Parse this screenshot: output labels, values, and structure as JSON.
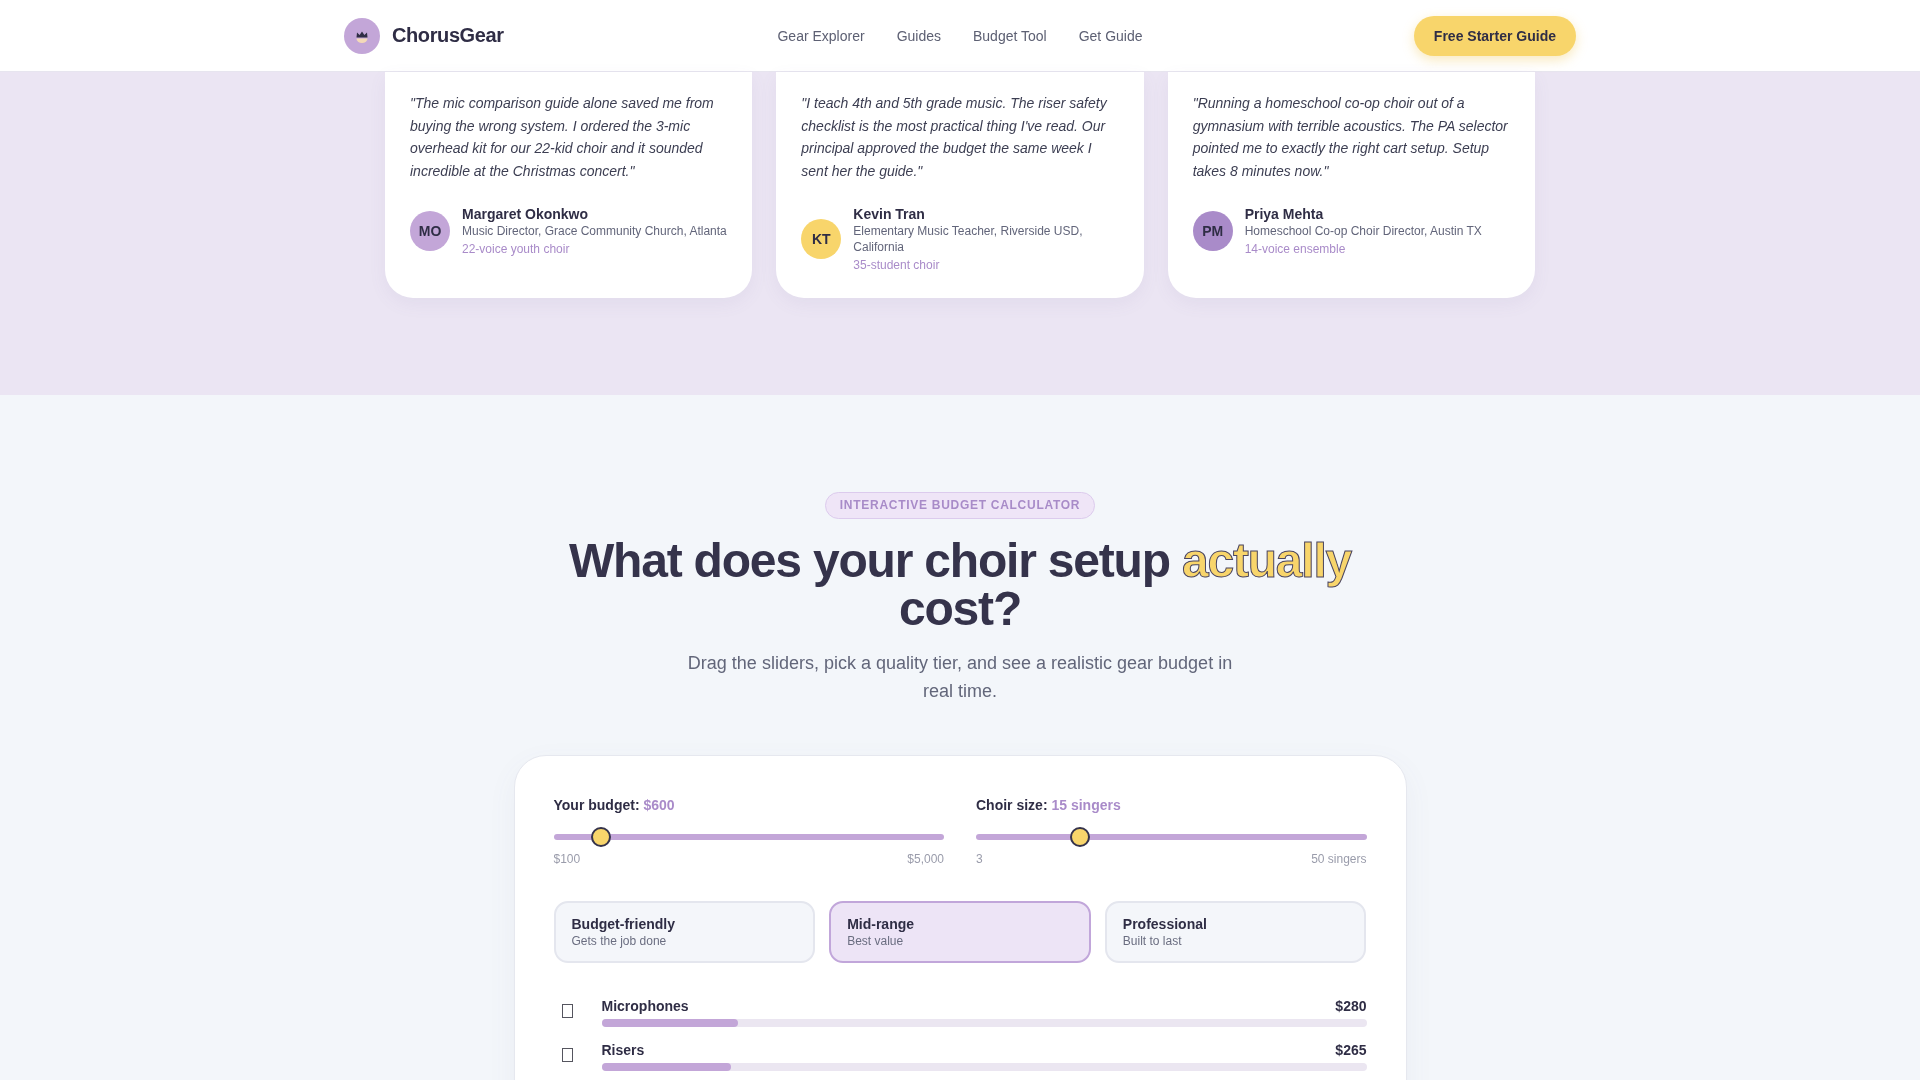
{
  "header": {
    "brand": "ChorusGear",
    "nav": [
      "Gear Explorer",
      "Guides",
      "Budget Tool",
      "Get Guide"
    ],
    "cta": "Free Starter Guide"
  },
  "testimonials": [
    {
      "quote": "\"The mic comparison guide alone saved me from buying the wrong system. I ordered the 3-mic overhead kit for our 22-kid choir and it sounded incredible at the Christmas concert.\"",
      "initials": "MO",
      "name": "Margaret Okonkwo",
      "role": "Music Director, Grace Community Church, Atlanta",
      "group": "22-voice youth choir",
      "color": "#c3a6d8"
    },
    {
      "quote": "\"I teach 4th and 5th grade music. The riser safety checklist is the most practical thing I've read. Our principal approved the budget the same week I sent her the guide.\"",
      "initials": "KT",
      "name": "Kevin Tran",
      "role": "Elementary Music Teacher, Riverside USD, California",
      "group": "35-student choir",
      "color": "#f8d56b"
    },
    {
      "quote": "\"Running a homeschool co-op choir out of a gymnasium with terrible acoustics. The PA selector pointed me to exactly the right cart setup. Setup takes 8 minutes now.\"",
      "initials": "PM",
      "name": "Priya Mehta",
      "role": "Homeschool Co-op Choir Director, Austin TX",
      "group": "14-voice ensemble",
      "color": "#a98bc9"
    }
  ],
  "calculator": {
    "badge": "INTERACTIVE BUDGET CALCULATOR",
    "heading": {
      "before": "What does your choir setup",
      "highlight": "actually",
      "after": "cost?"
    },
    "subtitle": "Drag the sliders, pick a quality tier, and see a realistic gear budget in real time.",
    "sliders": [
      {
        "label": "Your budget:",
        "value": "$600",
        "level": 0.102,
        "min": "$100",
        "max": "$5,000"
      },
      {
        "label": "Choir size:",
        "value": "15 singers",
        "level": 0.255,
        "min": "3",
        "max": "50 singers"
      }
    ],
    "tiers": [
      {
        "name": "Budget-friendly",
        "note": "Gets the job done",
        "selected": false
      },
      {
        "name": "Mid-range",
        "note": "Best value",
        "selected": true
      },
      {
        "name": "Professional",
        "note": "Built to last",
        "selected": false
      }
    ],
    "items": [
      {
        "name": "Microphones",
        "amount": "$280",
        "level": 0.178
      },
      {
        "name": "Risers",
        "amount": "$265",
        "level": 0.169
      }
    ]
  }
}
